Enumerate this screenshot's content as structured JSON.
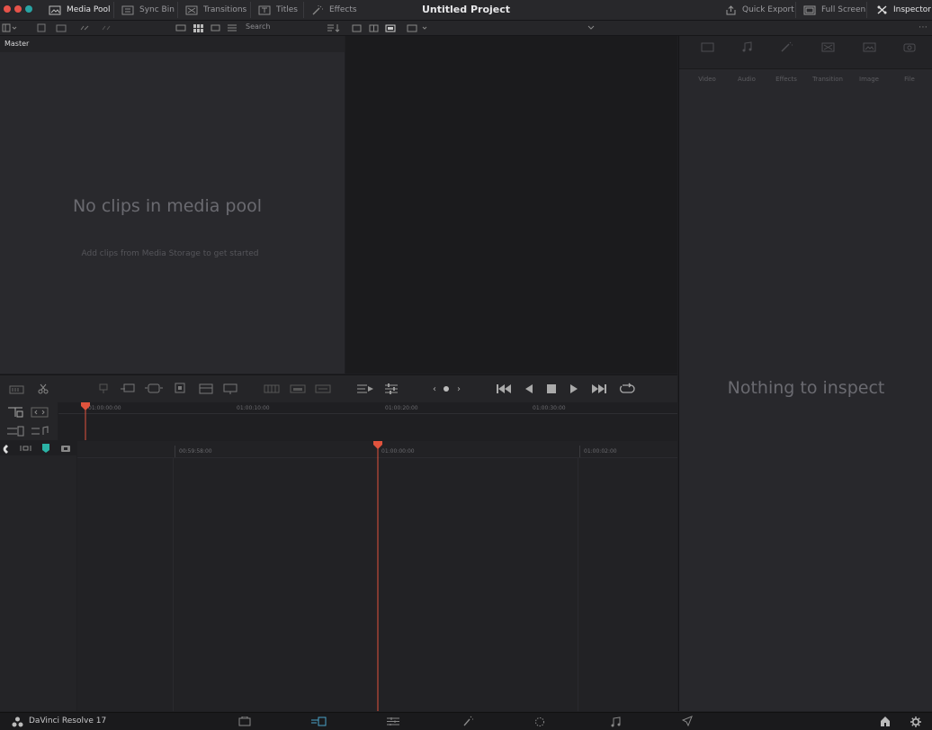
{
  "topbar": {
    "media_pool": "Media Pool",
    "sync_bin": "Sync Bin",
    "transitions": "Transitions",
    "titles": "Titles",
    "effects": "Effects",
    "project_title": "Untitled Project",
    "quick_export": "Quick Export",
    "full_screen": "Full Screen",
    "inspector": "Inspector"
  },
  "toolbar": {
    "search_label": "Search"
  },
  "media_pool": {
    "bin_label": "Master",
    "empty_title": "No clips in media pool",
    "empty_hint": "Add clips from Media Storage to get started"
  },
  "inspector": {
    "tabs": [
      "Video",
      "Audio",
      "Effects",
      "Transition",
      "Image",
      "File"
    ],
    "empty_text": "Nothing to inspect"
  },
  "timeline": {
    "upper_ruler": [
      "01:00:00:00",
      "01:00:10:00",
      "01:00:20:00",
      "01:00:30:00"
    ],
    "lower_ruler": [
      "00:59:58:00",
      "01:00:00:00",
      "01:00:02:00"
    ]
  },
  "bottombar": {
    "app_name": "DaVinci Resolve 17"
  },
  "colors": {
    "accent": "#e0533d",
    "playhead": "#e0533d",
    "track_marker": "#2bb3a6"
  }
}
